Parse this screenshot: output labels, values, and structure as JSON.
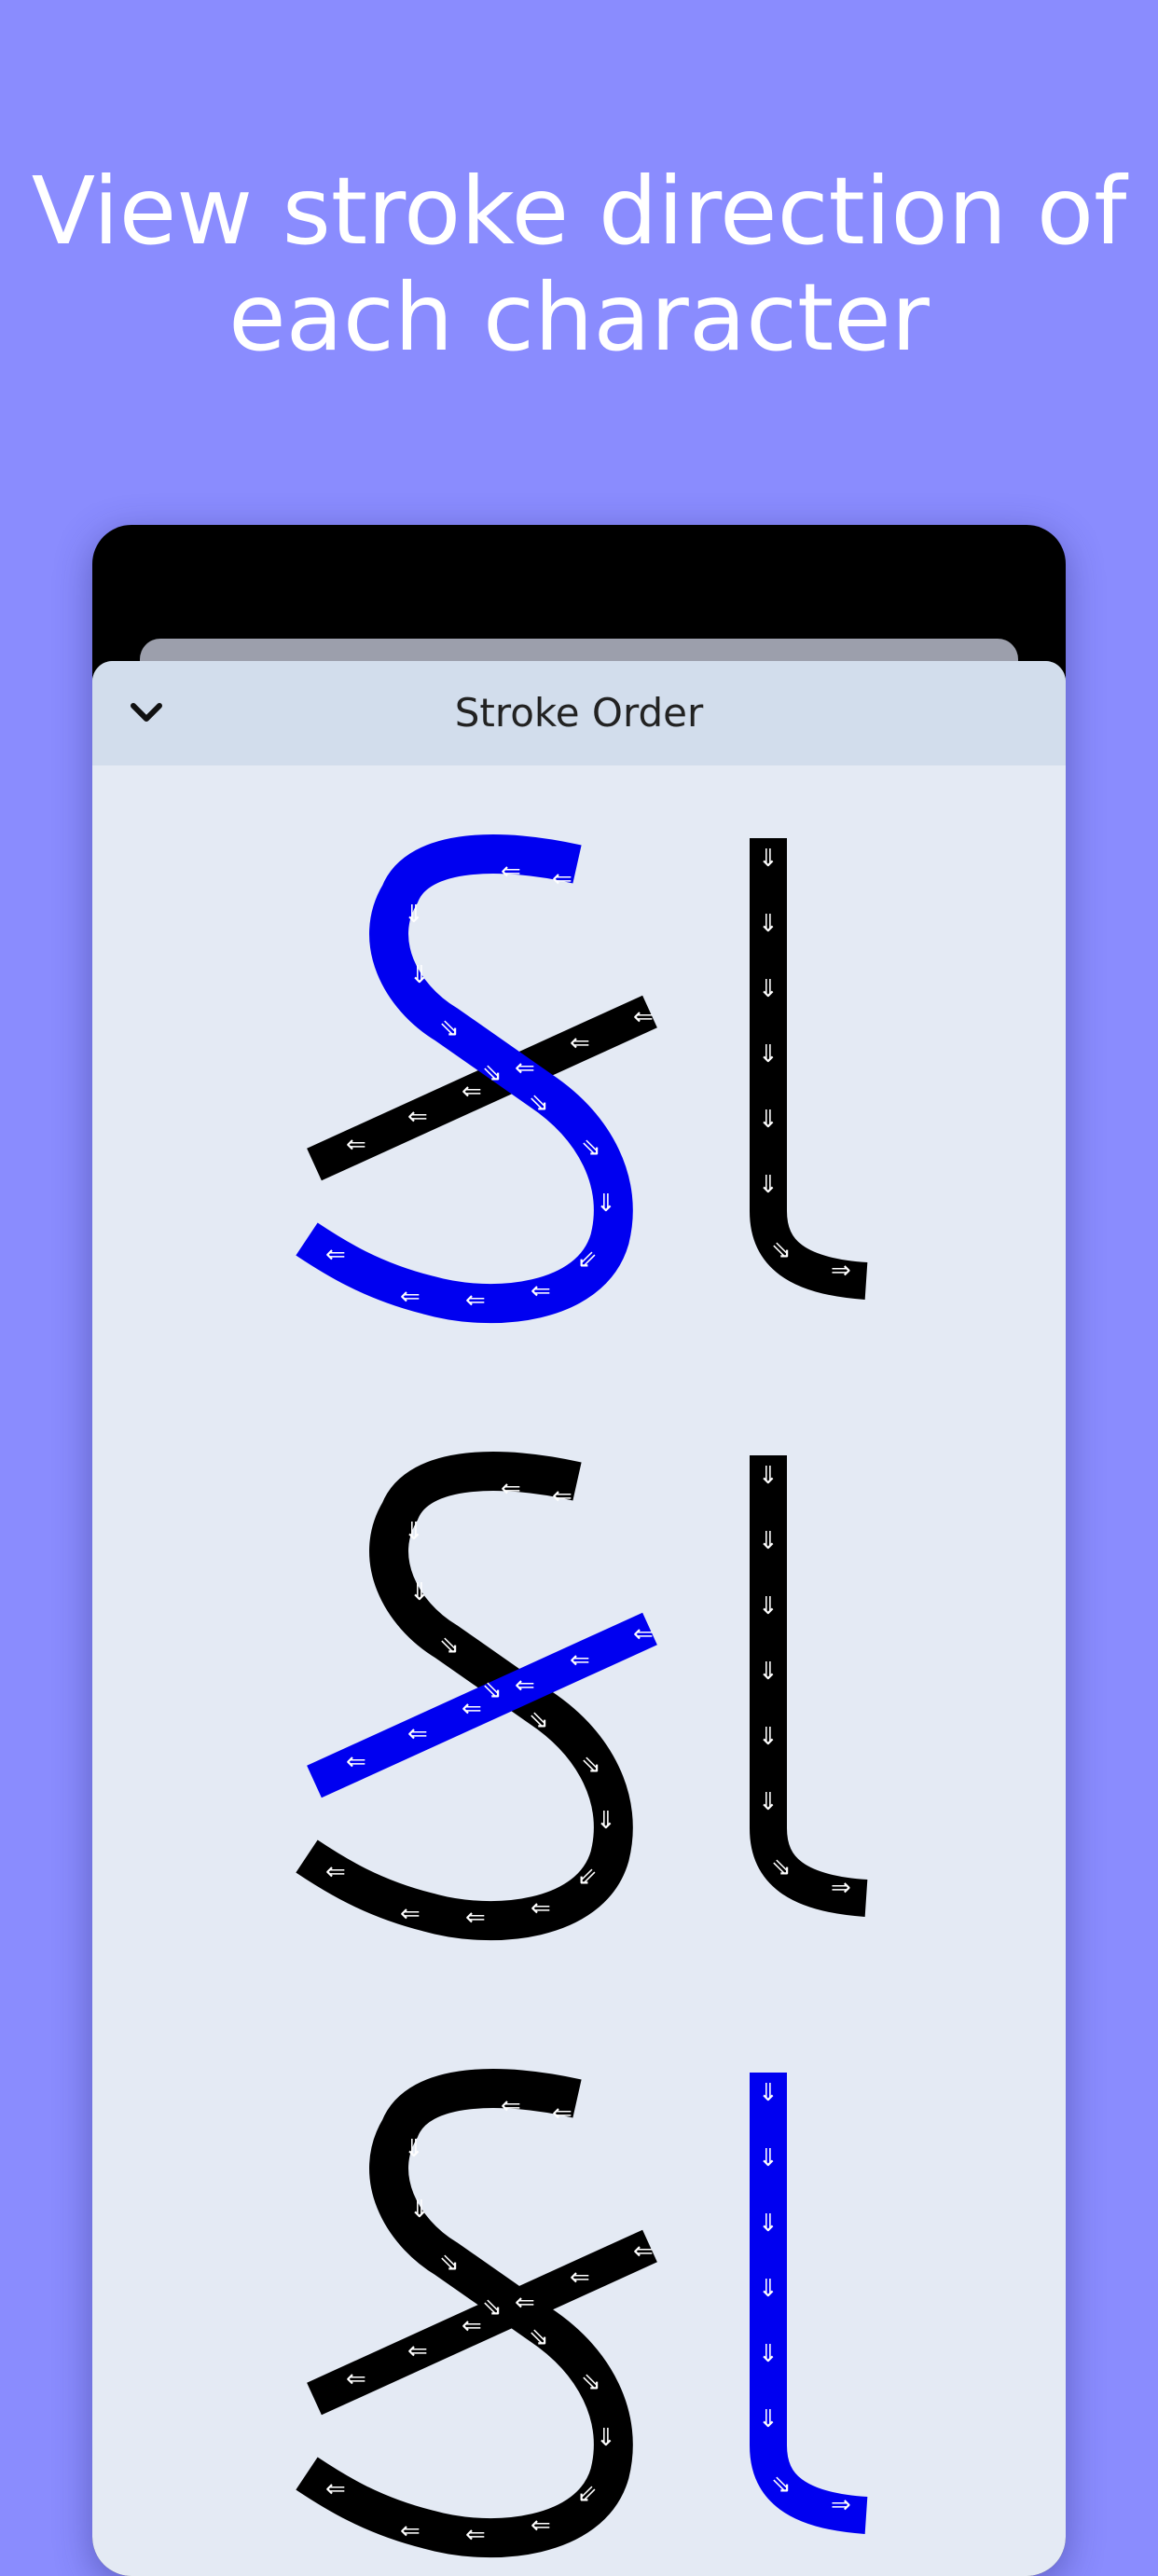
{
  "headline": {
    "line1": "View stroke direction of",
    "line2": "each character"
  },
  "sheet": {
    "title": "Stroke Order",
    "collapse_icon": "chevron-down-icon"
  },
  "colors": {
    "background": "#8a8cfe",
    "highlight": "#0000f0",
    "stroke": "#000000",
    "sheet": "#e4eaf4",
    "nav": "#d2ddec"
  },
  "stroke_frames": [
    {
      "highlighted_stroke": 1
    },
    {
      "highlighted_stroke": 2
    },
    {
      "highlighted_stroke": 3
    }
  ]
}
